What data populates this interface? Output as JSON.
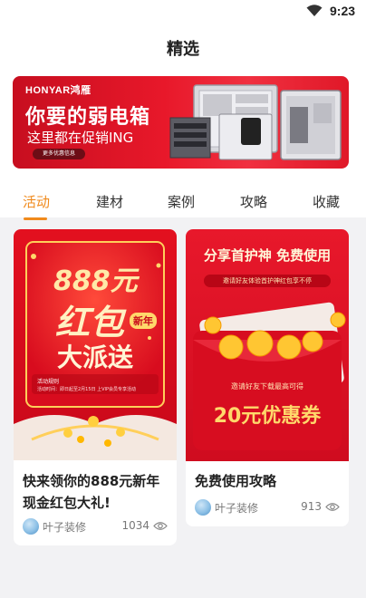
{
  "status": {
    "time": "9:23"
  },
  "header": {
    "title": "精选"
  },
  "banner": {
    "brand": "HONYAR鸿雁",
    "headline": "你要的弱电箱",
    "subline": "这里都在促销ING",
    "button": "更多优惠信息"
  },
  "tabs": [
    {
      "label": "活动",
      "active": true
    },
    {
      "label": "建材"
    },
    {
      "label": "案例"
    },
    {
      "label": "攻略"
    },
    {
      "label": "收藏"
    }
  ],
  "cards": [
    {
      "title_line1": "快来领你的888元新年",
      "title_line2": "现金红包大礼!",
      "author": "叶子装修",
      "views": "1034",
      "poster": {
        "amount": "888元",
        "word": "红包",
        "tag": "新年",
        "headline": "大派送",
        "small_title": "活动规则",
        "small_text": "活动时间：即日起至2月15日 上VIP会员专享活动"
      }
    },
    {
      "title_line1": "免费使用攻略",
      "author": "叶子装修",
      "views": "913",
      "poster": {
        "headline": "分享首护神 免费使用",
        "sub": "邀请好友体验首护神红包享不停",
        "invite": "邀请好友下载最高可得",
        "coupon": "20元优惠券"
      }
    }
  ]
}
